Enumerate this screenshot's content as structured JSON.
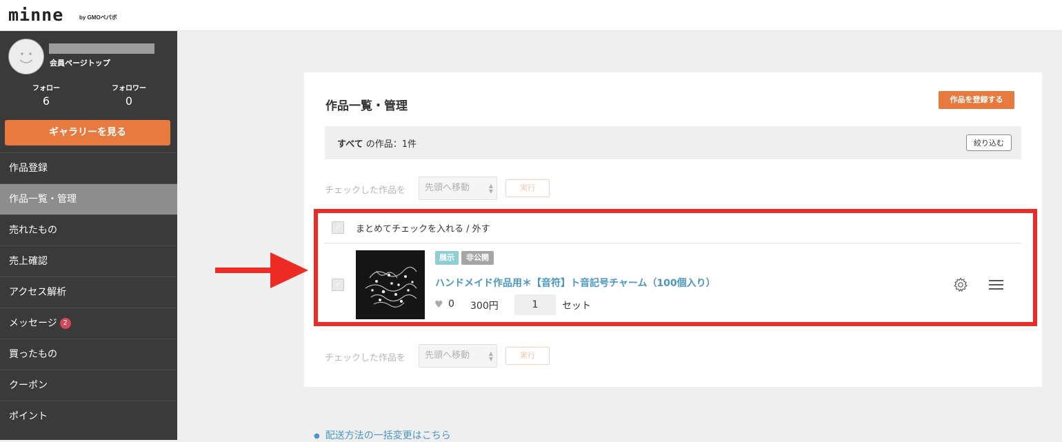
{
  "header": {
    "logo": "minne",
    "logo_sub": "by GMOペパボ"
  },
  "sidebar": {
    "member_link": "会員ページトップ",
    "follow_label": "フォロー",
    "follow_count": "6",
    "follower_label": "フォロワー",
    "follower_count": "0",
    "gallery_button": "ギャラリーを見る",
    "items": [
      {
        "label": "作品登録"
      },
      {
        "label": "作品一覧・管理"
      },
      {
        "label": "売れたもの"
      },
      {
        "label": "売上確認"
      },
      {
        "label": "アクセス解析"
      },
      {
        "label": "メッセージ",
        "badge": "2"
      },
      {
        "label": "買ったもの"
      },
      {
        "label": "クーポン"
      },
      {
        "label": "ポイント"
      }
    ]
  },
  "main": {
    "title": "作品一覧・管理",
    "register_button": "作品を登録する",
    "filter": {
      "scope": "すべて",
      "suffix": "の作品：1件",
      "narrow_button": "絞り込む"
    },
    "action": {
      "label": "チェックした作品を",
      "select_value": "先頭へ移動",
      "execute_button": "実行"
    },
    "bulk_check_label": "まとめてチェックを入れる / 外す",
    "item": {
      "tags": [
        "展示",
        "非公開"
      ],
      "title": "ハンドメイド作品用＊【音符】ト音記号チャーム（100個入り）",
      "likes": "0",
      "price": "300円",
      "quantity": "1",
      "unit": "セット"
    },
    "bottom_link": "配送方法の一括変更はこちら"
  },
  "colors": {
    "accent": "#e8793f",
    "link": "#4a97c5",
    "highlight": "#ee2a24",
    "tag_display": "#8ecfd3",
    "tag_private": "#a5a5a5"
  }
}
